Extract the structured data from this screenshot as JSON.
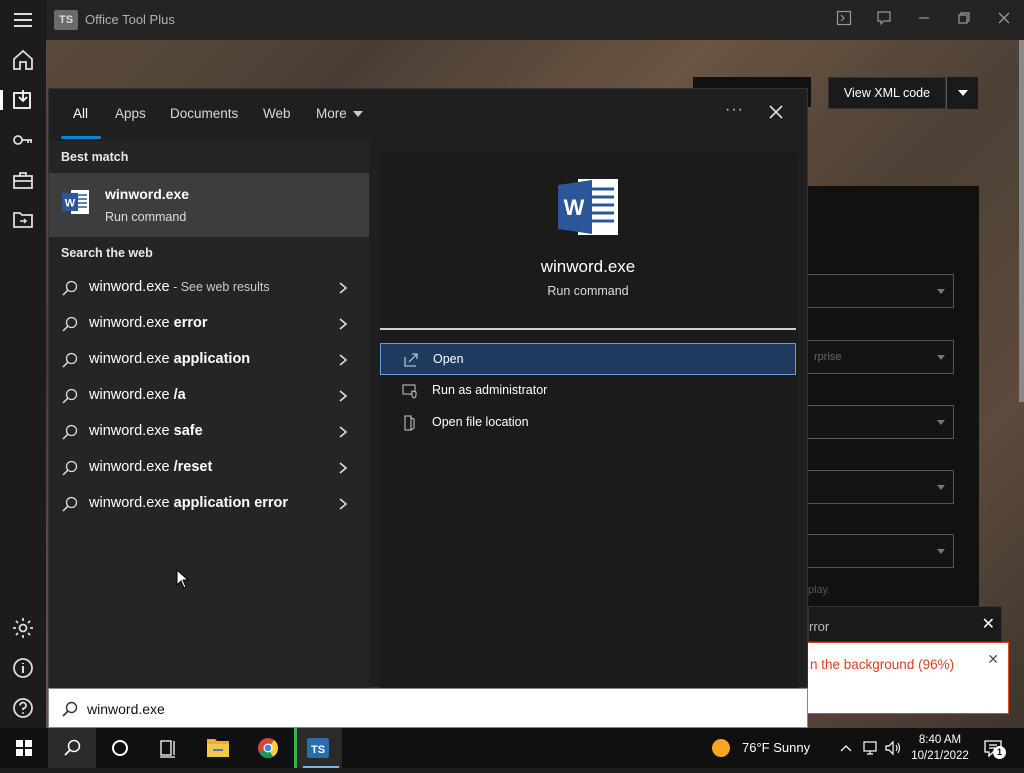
{
  "app": {
    "title": "Office Tool Plus",
    "logo_text": "TS",
    "view_xml_label": "View XML code",
    "error_card_text": "rror",
    "toast_text": "n the background (96%)",
    "faint_texts": [
      "rprise",
      "play."
    ]
  },
  "search": {
    "tabs": [
      {
        "label": "All"
      },
      {
        "label": "Apps"
      },
      {
        "label": "Documents"
      },
      {
        "label": "Web"
      },
      {
        "label": "More"
      }
    ],
    "more_dots": "···",
    "best_match_heading": "Best match",
    "best_match": {
      "name": "winword.exe",
      "sub": "Run command"
    },
    "web_heading": "Search the web",
    "web_results": [
      {
        "prefix": "winword.exe",
        "bold": "",
        "small": " - See web results"
      },
      {
        "prefix": "winword.exe ",
        "bold": "error",
        "small": ""
      },
      {
        "prefix": "winword.exe ",
        "bold": "application",
        "small": ""
      },
      {
        "prefix": "winword.exe ",
        "bold": "/a",
        "small": ""
      },
      {
        "prefix": "winword.exe ",
        "bold": "safe",
        "small": ""
      },
      {
        "prefix": "winword.exe ",
        "bold": "/reset",
        "small": ""
      },
      {
        "prefix": "winword.exe ",
        "bold": "application error",
        "small": ""
      }
    ],
    "detail": {
      "name": "winword.exe",
      "sub": "Run command",
      "actions": [
        {
          "label": "Open",
          "icon": "open-icon",
          "selected": true
        },
        {
          "label": "Run as administrator",
          "icon": "admin-shield-icon",
          "selected": false
        },
        {
          "label": "Open file location",
          "icon": "folder-location-icon",
          "selected": false
        }
      ]
    },
    "query": "winword.exe"
  },
  "taskbar": {
    "weather": "76°F  Sunny",
    "time": "8:40 AM",
    "date": "10/21/2022",
    "notification_count": "1"
  },
  "colors": {
    "accent": "#0a84d8",
    "selected_bg": "#1e3a5e",
    "word_blue": "#2b579a",
    "toast_text": "#d9421a"
  }
}
